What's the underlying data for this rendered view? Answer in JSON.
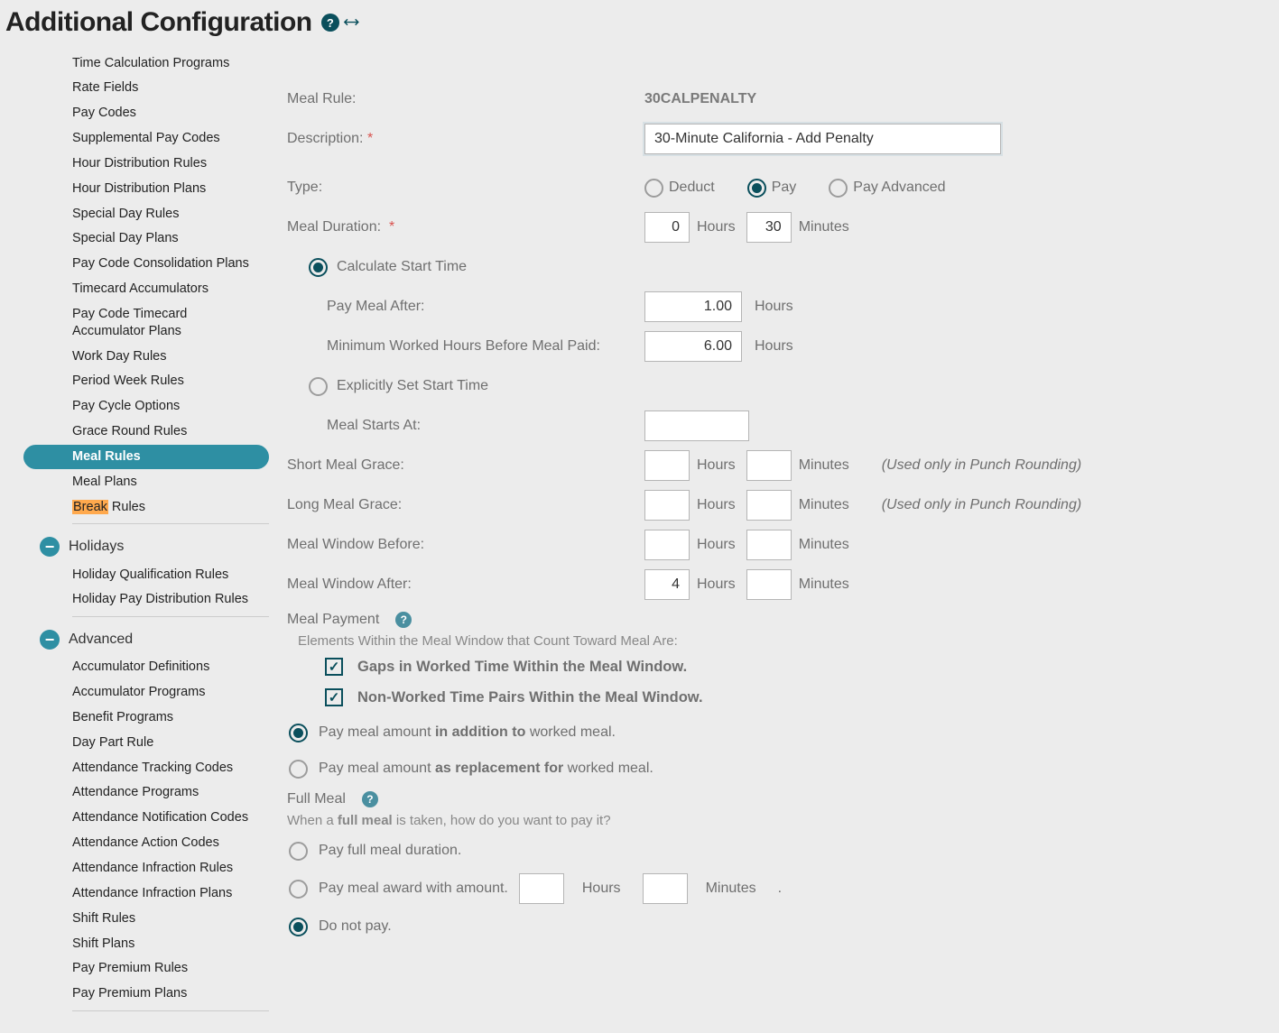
{
  "title": "Additional Configuration",
  "sidebar": {
    "group1": [
      "Time Calculation Programs",
      "Rate Fields",
      "Pay Codes",
      "Supplemental Pay Codes",
      "Hour Distribution Rules",
      "Hour Distribution Plans",
      "Special Day Rules",
      "Special Day Plans",
      "Pay Code Consolidation Plans",
      "Timecard Accumulators",
      "Pay Code Timecard Accumulator Plans",
      "Work Day Rules",
      "Period Week Rules",
      "Pay Cycle Options",
      "Grace Round Rules",
      "Meal Rules",
      "Meal Plans"
    ],
    "break_hl": "Break",
    "break_rest": " Rules",
    "holidays_label": "Holidays",
    "holidays_items": [
      "Holiday Qualification Rules",
      "Holiday Pay Distribution Rules"
    ],
    "advanced_label": "Advanced",
    "advanced_items": [
      "Accumulator Definitions",
      "Accumulator Programs",
      "Benefit Programs",
      "Day Part Rule",
      "Attendance Tracking Codes",
      "Attendance Programs",
      "Attendance Notification Codes",
      "Attendance Action Codes",
      "Attendance Infraction Rules",
      "Attendance Infraction Plans",
      "Shift Rules",
      "Shift Plans",
      "Pay Premium Rules",
      "Pay Premium Plans"
    ]
  },
  "form": {
    "meal_rule_label": "Meal Rule:",
    "meal_rule_value": "30CALPENALTY",
    "description_label": "Description:",
    "description_value": "30-Minute California - Add Penalty",
    "type_label": "Type:",
    "type_deduct": "Deduct",
    "type_pay": "Pay",
    "type_pay_adv": "Pay Advanced",
    "meal_duration_label": "Meal Duration:",
    "dur_hours": "0",
    "dur_minutes": "30",
    "hours_unit": "Hours",
    "minutes_unit": "Minutes",
    "calc_start": "Calculate Start Time",
    "pay_meal_after_label": "Pay Meal After:",
    "pay_meal_after_value": "1.00",
    "min_worked_label": "Minimum Worked Hours Before Meal Paid:",
    "min_worked_value": "6.00",
    "explicit_start": "Explicitly Set Start Time",
    "meal_starts_label": "Meal Starts At:",
    "short_grace_label": "Short Meal Grace:",
    "long_grace_label": "Long Meal Grace:",
    "window_before_label": "Meal Window Before:",
    "window_after_label": "Meal Window After:",
    "window_after_hours": "4",
    "punch_note": "(Used only in Punch Rounding)",
    "meal_payment_label": "Meal Payment",
    "elements_text": "Elements Within the Meal Window that Count Toward Meal Are:",
    "chk_gaps": "Gaps in Worked Time Within the Meal Window.",
    "chk_nonworked": "Non-Worked Time Pairs Within the Meal Window.",
    "pay_addition_pre": "Pay meal amount ",
    "pay_addition_b": "in addition to",
    "pay_addition_post": " worked meal.",
    "pay_replace_pre": "Pay meal amount ",
    "pay_replace_b": "as replacement for",
    "pay_replace_post": " worked meal.",
    "full_meal_label": "Full Meal",
    "full_meal_q_pre": "When a ",
    "full_meal_q_b": "full meal",
    "full_meal_q_post": " is taken, how do you want to pay it?",
    "opt_full_duration": "Pay full meal duration.",
    "opt_award": "Pay meal award with amount.",
    "opt_donotpay": "Do not pay.",
    "dot": "."
  }
}
